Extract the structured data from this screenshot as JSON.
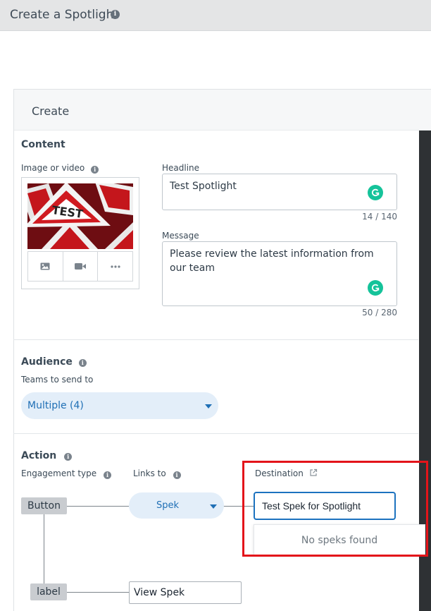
{
  "page": {
    "title": "Create a Spotlight"
  },
  "panel": {
    "header": "Create"
  },
  "content": {
    "section_title": "Content",
    "media_label": "Image or video",
    "media_thumb_text": "TEST",
    "headline": {
      "label": "Headline",
      "value": "Test Spotlight",
      "counter": "14 / 140"
    },
    "message": {
      "label": "Message",
      "value": "Please review the latest information from our team",
      "counter": "50 / 280"
    }
  },
  "audience": {
    "section_title": "Audience",
    "teams_label": "Teams to send to",
    "teams_value": "Multiple (4)"
  },
  "action": {
    "section_title": "Action",
    "engagement_label": "Engagement type",
    "links_label": "Links to",
    "destination_label": "Destination",
    "engagement_value": "Button",
    "links_value": "Spek",
    "destination_value": "Test Spek for Spotlight",
    "destination_empty": "No speks found",
    "label_tag": "label",
    "label_value": "View Spek"
  },
  "colors": {
    "accent": "#1f6fb5",
    "pill_bg": "#e3eef9",
    "highlight": "#e3141a",
    "grammarly": "#15c39a"
  },
  "icons": {
    "title_info": "info-icon",
    "image": "image-icon",
    "video": "video-camera-icon",
    "more": "more-dots-icon",
    "external_link": "external-link-icon"
  }
}
